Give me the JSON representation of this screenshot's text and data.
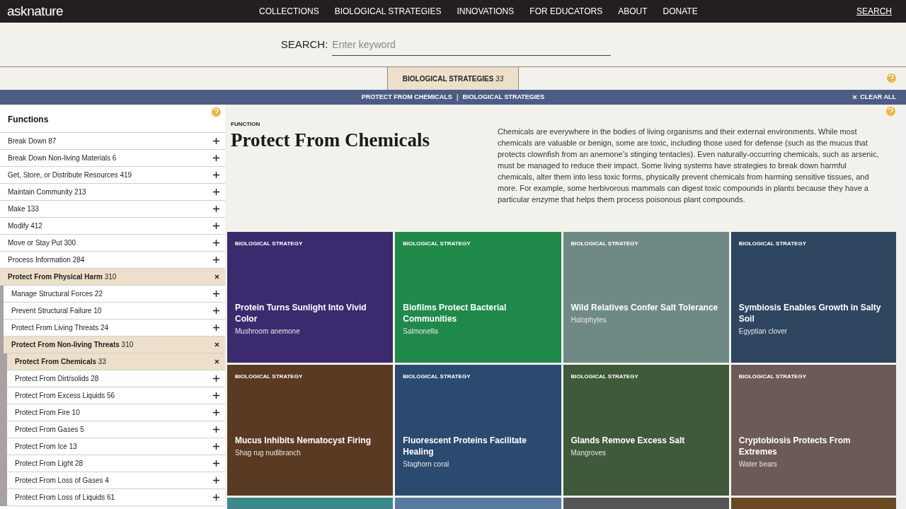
{
  "header": {
    "logo": "asknature",
    "nav": [
      {
        "label": "COLLECTIONS"
      },
      {
        "label": "BIOLOGICAL STRATEGIES"
      },
      {
        "label": "INNOVATIONS"
      },
      {
        "label": "FOR EDUCATORS"
      },
      {
        "label": "ABOUT"
      },
      {
        "label": "DONATE"
      }
    ],
    "search_link": "SEARCH"
  },
  "search": {
    "label": "SEARCH:",
    "placeholder": "Enter keyword"
  },
  "tabs": [
    {
      "label": "BIOLOGICAL STRATEGIES",
      "count": "33",
      "selected": true
    }
  ],
  "filters": {
    "items": [
      "PROTECT FROM CHEMICALS",
      "BIOLOGICAL STRATEGIES"
    ],
    "separator": "|",
    "clear": "CLEAR ALL"
  },
  "sidebar": {
    "title": "Functions",
    "items": [
      {
        "label": "Break Down",
        "count": "87",
        "expanded": false
      },
      {
        "label": "Break Down Non-living Materials",
        "count": "6",
        "expanded": false
      },
      {
        "label": "Get, Store, or Distribute Resources",
        "count": "419",
        "expanded": false
      },
      {
        "label": "Maintain Community",
        "count": "213",
        "expanded": false
      },
      {
        "label": "Make",
        "count": "133",
        "expanded": false
      },
      {
        "label": "Modify",
        "count": "412",
        "expanded": false
      },
      {
        "label": "Move or Stay Put",
        "count": "300",
        "expanded": false
      },
      {
        "label": "Process Information",
        "count": "284",
        "expanded": false
      },
      {
        "label": "Protect From Physical Harm",
        "count": "310",
        "expanded": true,
        "children": [
          {
            "label": "Manage Structural Forces",
            "count": "22",
            "expanded": false
          },
          {
            "label": "Prevent Structural Failure",
            "count": "10",
            "expanded": false
          },
          {
            "label": "Protect From Living Threats",
            "count": "24",
            "expanded": false
          },
          {
            "label": "Protect From Non-living Threats",
            "count": "310",
            "expanded": true,
            "children": [
              {
                "label": "Protect From Chemicals",
                "count": "33",
                "expanded": true
              },
              {
                "label": "Protect From Dirt/solids",
                "count": "28",
                "expanded": false
              },
              {
                "label": "Protect From Excess Liquids",
                "count": "56",
                "expanded": false
              },
              {
                "label": "Protect From Fire",
                "count": "10",
                "expanded": false
              },
              {
                "label": "Protect From Gases",
                "count": "5",
                "expanded": false
              },
              {
                "label": "Protect From Ice",
                "count": "13",
                "expanded": false
              },
              {
                "label": "Protect From Light",
                "count": "28",
                "expanded": false
              },
              {
                "label": "Protect From Loss of Gases",
                "count": "4",
                "expanded": false
              },
              {
                "label": "Protect From Loss of Liquids",
                "count": "61",
                "expanded": false
              }
            ]
          }
        ]
      }
    ]
  },
  "function": {
    "kicker": "FUNCTION",
    "title": "Protect From Chemicals",
    "description": "Chemicals are everywhere in the bodies of living organisms and their external environments. While most chemicals are valuable or benign, some are toxic, including those used for defense (such as the mucus that protects clownfish from an anemone’s stinging tentacles). Even naturally-occurring chemicals, such as arsenic, must be managed to reduce their impact. Some living systems have strategies to break down harmful chemicals, alter them into less toxic forms, physically prevent chemicals from harming sensitive tissues, and more. For example, some herbivorous mammals can digest toxic compounds in plants because they have a particular enzyme that helps them process poisonous plant compounds."
  },
  "cards": [
    {
      "tag": "BIOLOGICAL STRATEGY",
      "title": "Protein Turns Sunlight Into Vivid Color",
      "subtitle": "Mushroom anemone"
    },
    {
      "tag": "BIOLOGICAL STRATEGY",
      "title": "Biofilms Protect Bacterial Communities",
      "subtitle": "Salmonella"
    },
    {
      "tag": "BIOLOGICAL STRATEGY",
      "title": "Wild Relatives Confer Salt Tolerance",
      "subtitle": "Halophytes"
    },
    {
      "tag": "BIOLOGICAL STRATEGY",
      "title": "Symbiosis Enables Growth in Salty Soil",
      "subtitle": "Egyptian clover"
    },
    {
      "tag": "BIOLOGICAL STRATEGY",
      "title": "Mucus Inhibits Nematocyst Firing",
      "subtitle": "Shag rug nudibranch"
    },
    {
      "tag": "BIOLOGICAL STRATEGY",
      "title": "Fluorescent Proteins Facilitate Healing",
      "subtitle": "Staghorn coral"
    },
    {
      "tag": "BIOLOGICAL STRATEGY",
      "title": "Glands Remove Excess Salt",
      "subtitle": "Mangroves"
    },
    {
      "tag": "BIOLOGICAL STRATEGY",
      "title": "Cryptobiosis Protects From Extremes",
      "subtitle": "Water bears"
    }
  ]
}
